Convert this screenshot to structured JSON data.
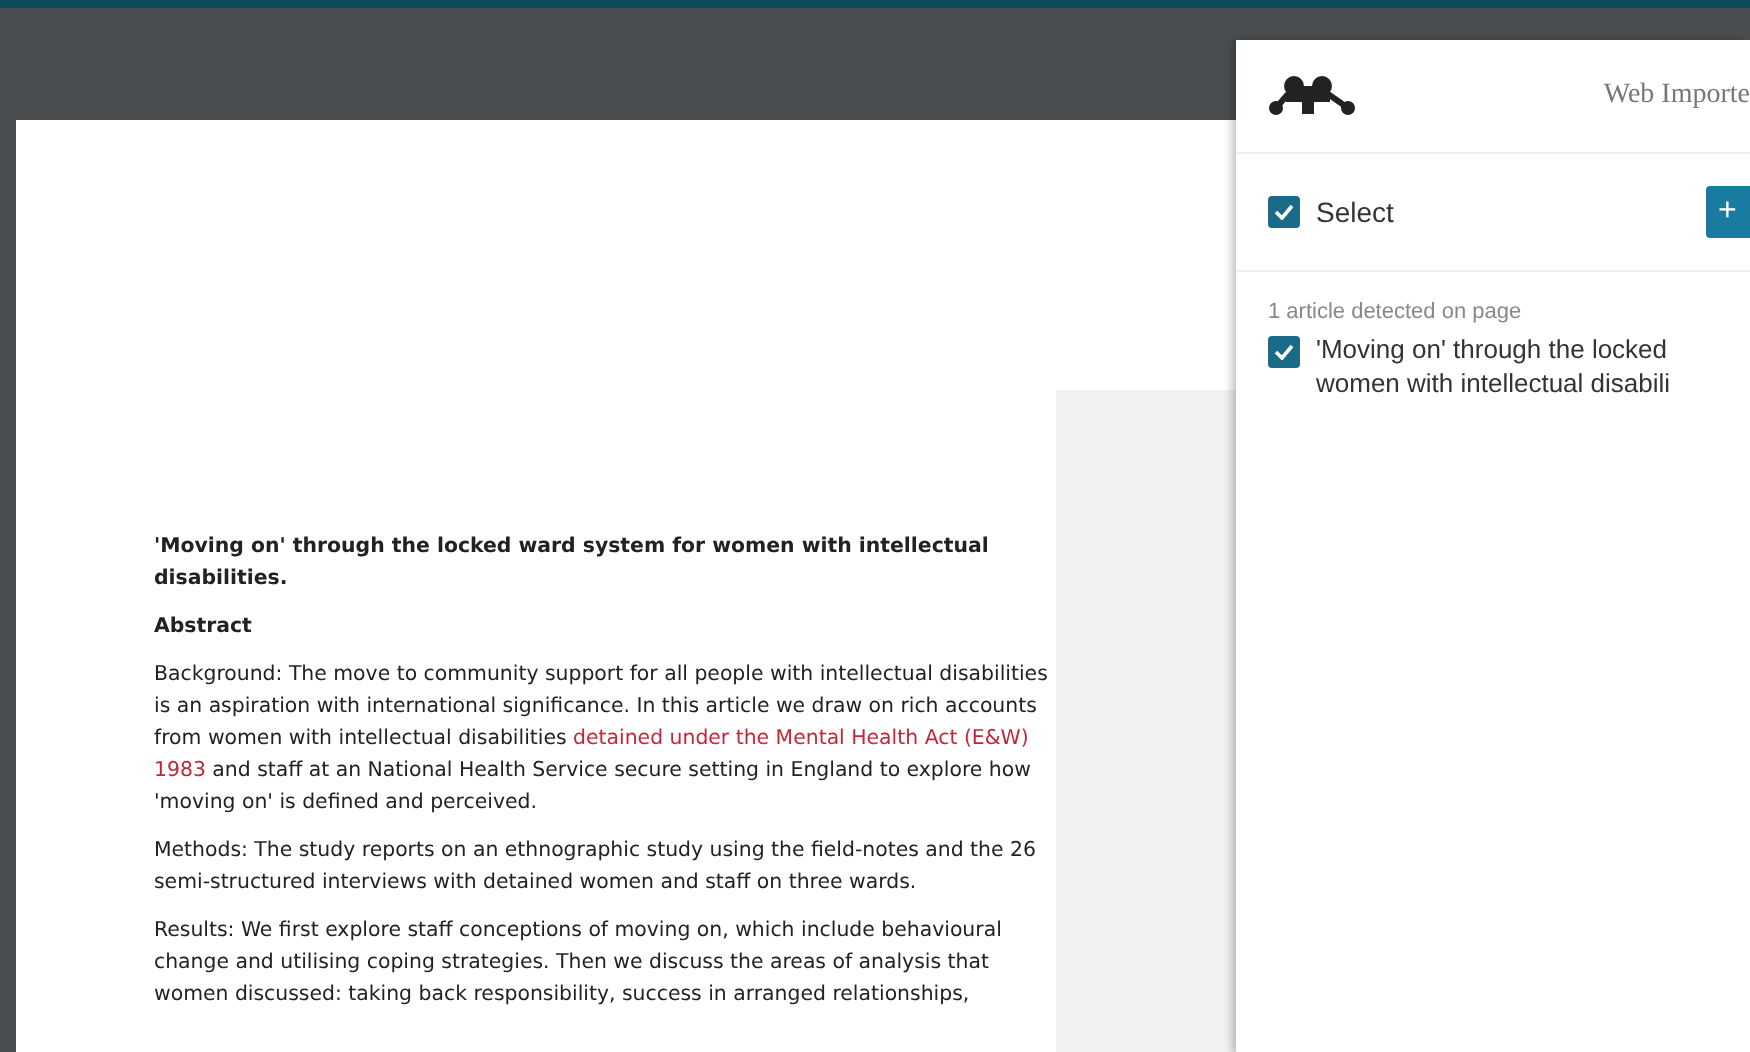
{
  "document": {
    "title": "'Moving on' through the locked ward system for women with intellectual disabilities.",
    "heading": "Abstract",
    "paragraphs": [
      {
        "segments": [
          {
            "text": "Background: The move to community support for all people with intellectual disabilities is an aspiration with international significance. In this article we draw on rich accounts from women with intellectual disabilities ",
            "highlighted": false
          },
          {
            "text": "detained under the Mental Health Act (E&W) 1983",
            "highlighted": true
          },
          {
            "text": " and staff at an National Health Service secure setting in England to explore how 'moving on' is defined and perceived.",
            "highlighted": false
          }
        ]
      },
      {
        "segments": [
          {
            "text": "Methods: The study reports on an ethnographic study using the field-notes and the 26 semi-structured interviews with detained women and staff on three wards.",
            "highlighted": false
          }
        ]
      },
      {
        "segments": [
          {
            "text": "Results: We first explore staff conceptions of moving on, which include behavioural change and utilising coping strategies. Then we discuss the areas of analysis that women discussed: taking back responsibility, success in arranged relationships,",
            "highlighted": false
          }
        ]
      }
    ]
  },
  "panel": {
    "title": "Web Importe",
    "select": {
      "label": "Select",
      "checked": true
    },
    "add_button": "+",
    "detected": "1 article detected on page",
    "articles": [
      {
        "title": "'Moving on' through the locked\nwomen with intellectual disabili",
        "checked": true
      }
    ]
  }
}
